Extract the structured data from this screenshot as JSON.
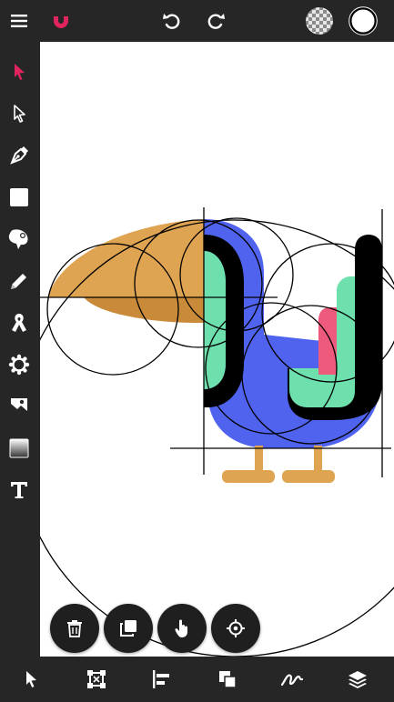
{
  "app": {
    "brand_color": "#e0245e",
    "background_color": "#262626",
    "canvas_color": "#ffffff"
  },
  "top_bar": {
    "icons": [
      "menu-icon",
      "magnet-icon",
      "undo-icon",
      "redo-icon",
      "transparency-fill-icon",
      "color-swatch-icon"
    ],
    "current_color": "#ffffff"
  },
  "tools": [
    {
      "name": "select-tool",
      "icon": "pointer-filled-icon",
      "active": true
    },
    {
      "name": "direct-select-tool",
      "icon": "pointer-outline-icon"
    },
    {
      "name": "pen-tool",
      "icon": "pen-nib-icon"
    },
    {
      "name": "shape-tool",
      "icon": "square-icon"
    },
    {
      "name": "blob-tool",
      "icon": "blob-icon"
    },
    {
      "name": "pencil-tool",
      "icon": "pencil-icon"
    },
    {
      "name": "calligraphy-tool",
      "icon": "ribbon-icon"
    },
    {
      "name": "symbol-tool",
      "icon": "gear-shape-icon"
    },
    {
      "name": "image-tool",
      "icon": "image-icon"
    },
    {
      "name": "gradient-tool",
      "icon": "gradient-icon"
    },
    {
      "name": "text-tool",
      "icon": "text-T-icon"
    }
  ],
  "canvas": {
    "illustration": "toucan",
    "colors": {
      "beak": "#dfa451",
      "beak_shadow": "#c98b3a",
      "body": "#4f63ee",
      "green": "#6ee0ad",
      "pink": "#ee5a7b",
      "black": "#000000",
      "legs": "#dfa451"
    }
  },
  "floating_actions": [
    "delete-icon",
    "duplicate-icon",
    "hand-icon",
    "target-icon"
  ],
  "bottom_bar": [
    "pointer-icon",
    "transform-icon",
    "align-left-icon",
    "arrange-icon",
    "path-icon",
    "layers-icon"
  ]
}
